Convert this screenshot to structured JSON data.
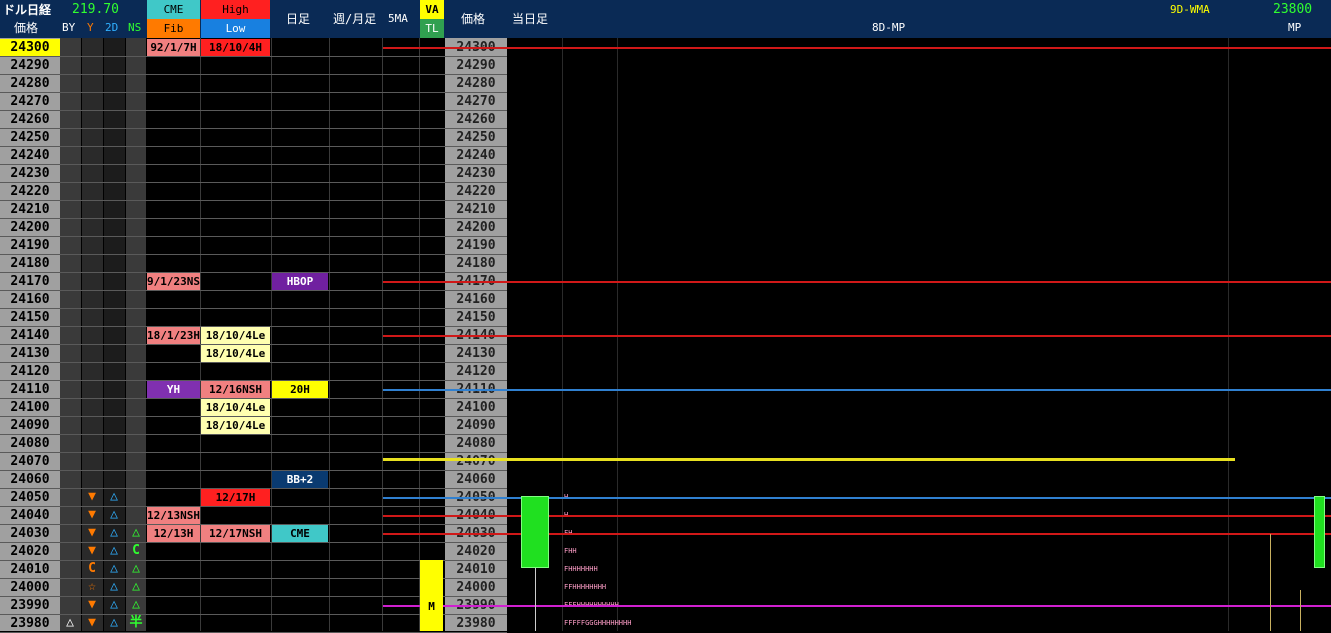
{
  "header": {
    "instrument": "ドル日経",
    "value": "219.70",
    "price_label": "価格",
    "col_by": "BY",
    "col_y": "Y",
    "col_2d": "2D",
    "col_ns": "NS",
    "cme": "CME",
    "fib": "Fib",
    "high": "High",
    "low": "Low",
    "daily": "日足",
    "weekly": "週/月足",
    "ma5": "5MA",
    "va": "VA",
    "tl": "TL",
    "price2": "価格",
    "today": "当日足",
    "mp8d": "8D-MP",
    "wma": "9D-WMA",
    "mp_value": "23800",
    "mp": "MP"
  },
  "prices": [
    "24300",
    "24290",
    "24280",
    "24270",
    "24260",
    "24250",
    "24240",
    "24230",
    "24220",
    "24210",
    "24200",
    "24190",
    "24180",
    "24170",
    "24160",
    "24150",
    "24140",
    "24130",
    "24120",
    "24110",
    "24100",
    "24090",
    "24080",
    "24070",
    "24060",
    "24050",
    "24040",
    "24030",
    "24020",
    "24010",
    "24000",
    "23990",
    "23980"
  ],
  "cells": [
    {
      "row": 0,
      "col": "cme",
      "text": "92/1/7H",
      "bg": "#f08080",
      "fg": "#000"
    },
    {
      "row": 0,
      "col": "hl",
      "text": "18/10/4H",
      "bg": "#ff2020",
      "fg": "#000"
    },
    {
      "row": 13,
      "col": "cme",
      "text": "9/1/23NS",
      "bg": "#f08080",
      "fg": "#000"
    },
    {
      "row": 13,
      "col": "d",
      "text": "HBOP",
      "bg": "#7020a0",
      "fg": "#fff"
    },
    {
      "row": 16,
      "col": "cme",
      "text": "18/1/23H",
      "bg": "#f08080",
      "fg": "#000"
    },
    {
      "row": 16,
      "col": "hl",
      "text": "18/10/4Le",
      "bg": "#ffffb0",
      "fg": "#000"
    },
    {
      "row": 17,
      "col": "hl",
      "text": "18/10/4Le",
      "bg": "#ffffb0",
      "fg": "#000"
    },
    {
      "row": 19,
      "col": "cme",
      "text": "YH",
      "bg": "#8030b0",
      "fg": "#fff"
    },
    {
      "row": 19,
      "col": "hl",
      "text": "12/16NSH",
      "bg": "#f08080",
      "fg": "#000"
    },
    {
      "row": 19,
      "col": "d",
      "text": "20H",
      "bg": "#ffff00",
      "fg": "#000"
    },
    {
      "row": 20,
      "col": "hl",
      "text": "18/10/4Le",
      "bg": "#ffffb0",
      "fg": "#000"
    },
    {
      "row": 21,
      "col": "hl",
      "text": "18/10/4Le",
      "bg": "#ffffb0",
      "fg": "#000"
    },
    {
      "row": 24,
      "col": "d",
      "text": "BB+2",
      "bg": "#0a3a70",
      "fg": "#fff"
    },
    {
      "row": 25,
      "col": "hl",
      "text": "12/17H",
      "bg": "#ff2020",
      "fg": "#000"
    },
    {
      "row": 26,
      "col": "cme",
      "text": "12/13NSH",
      "bg": "#f08080",
      "fg": "#000"
    },
    {
      "row": 27,
      "col": "cme",
      "text": "12/13H",
      "bg": "#f08080",
      "fg": "#000"
    },
    {
      "row": 27,
      "col": "hl",
      "text": "12/17NSH",
      "bg": "#f08080",
      "fg": "#000"
    },
    {
      "row": 27,
      "col": "d",
      "text": "CME",
      "bg": "#40c8c8",
      "fg": "#000"
    }
  ],
  "symbols": [
    {
      "row": 25,
      "col": "y",
      "text": "▼",
      "color": "#ff7a00"
    },
    {
      "row": 25,
      "col": "2d",
      "text": "△",
      "color": "#30b0ff"
    },
    {
      "row": 26,
      "col": "y",
      "text": "▼",
      "color": "#ff7a00"
    },
    {
      "row": 26,
      "col": "2d",
      "text": "△",
      "color": "#30b0ff"
    },
    {
      "row": 27,
      "col": "y",
      "text": "▼",
      "color": "#ff7a00"
    },
    {
      "row": 27,
      "col": "2d",
      "text": "△",
      "color": "#30b0ff"
    },
    {
      "row": 27,
      "col": "ns",
      "text": "△",
      "color": "#30ff30"
    },
    {
      "row": 28,
      "col": "y",
      "text": "▼",
      "color": "#ff7a00"
    },
    {
      "row": 28,
      "col": "2d",
      "text": "△",
      "color": "#30b0ff"
    },
    {
      "row": 28,
      "col": "ns",
      "text": "C",
      "color": "#30ff30"
    },
    {
      "row": 29,
      "col": "y",
      "text": "C",
      "color": "#ff7a00"
    },
    {
      "row": 29,
      "col": "2d",
      "text": "△",
      "color": "#30b0ff"
    },
    {
      "row": 29,
      "col": "ns",
      "text": "△",
      "color": "#30ff30"
    },
    {
      "row": 30,
      "col": "y",
      "text": "☆",
      "color": "#ff7a00"
    },
    {
      "row": 30,
      "col": "2d",
      "text": "△",
      "color": "#30b0ff"
    },
    {
      "row": 30,
      "col": "ns",
      "text": "△",
      "color": "#30ff30"
    },
    {
      "row": 31,
      "col": "y",
      "text": "▼",
      "color": "#ff7a00"
    },
    {
      "row": 31,
      "col": "2d",
      "text": "△",
      "color": "#30b0ff"
    },
    {
      "row": 31,
      "col": "ns",
      "text": "△",
      "color": "#30ff30"
    },
    {
      "row": 32,
      "col": "by",
      "text": "△",
      "color": "#ffffff"
    },
    {
      "row": 32,
      "col": "y",
      "text": "▼",
      "color": "#ff7a00"
    },
    {
      "row": 32,
      "col": "2d",
      "text": "△",
      "color": "#30b0ff"
    },
    {
      "row": 32,
      "col": "ns",
      "text": "半",
      "color": "#30ff30"
    }
  ],
  "va_marker": "M",
  "profile": [
    {
      "row": 25,
      "text": "H"
    },
    {
      "row": 26,
      "text": "H"
    },
    {
      "row": 27,
      "text": "FH"
    },
    {
      "row": 28,
      "text": "FHH"
    },
    {
      "row": 29,
      "text": "FHHHHHHH"
    },
    {
      "row": 30,
      "text": "FFHHHHHHHH"
    },
    {
      "row": 31,
      "text": "FFFHHHHHHHHHH"
    },
    {
      "row": 32,
      "text": "FFFFFGGGHHHHHHHH"
    }
  ],
  "levels": [
    {
      "row": 0,
      "color": "#d01818"
    },
    {
      "row": 13,
      "color": "#d01818"
    },
    {
      "row": 16,
      "color": "#d01818"
    },
    {
      "row": 19,
      "color": "#3080d0"
    },
    {
      "row": 25,
      "color": "#3080d0"
    },
    {
      "row": 26,
      "color": "#d01818"
    },
    {
      "row": 27,
      "color": "#d01818"
    },
    {
      "row": 31,
      "color": "#d020d0"
    }
  ]
}
